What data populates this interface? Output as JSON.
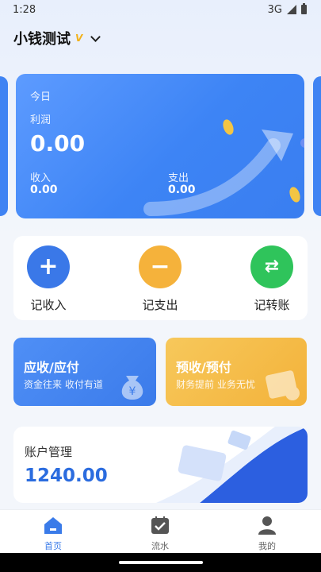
{
  "status_bar": {
    "time": "1:28",
    "network": "3G"
  },
  "header": {
    "title": "小钱测试",
    "vip": "V"
  },
  "today_card": {
    "date_label": "今日",
    "profit_label": "利润",
    "profit_value": "0.00",
    "income_label": "收入",
    "income_value": "0.00",
    "expense_label": "支出",
    "expense_value": "0.00"
  },
  "actions": {
    "income": {
      "label": "记收入",
      "icon": "plus-icon"
    },
    "expense": {
      "label": "记支出",
      "icon": "minus-icon"
    },
    "transfer": {
      "label": "记转账",
      "icon": "transfer-icon"
    }
  },
  "cards": {
    "receivable": {
      "title": "应收/应付",
      "subtitle": "资金往来 收付有道"
    },
    "prepaid": {
      "title": "预收/预付",
      "subtitle": "财务提前 业务无忧"
    }
  },
  "account": {
    "label": "账户管理",
    "value": "1240.00"
  },
  "bottom_nav": {
    "home": "首页",
    "flow": "流水",
    "me": "我的"
  },
  "colors": {
    "primary": "#3d84f5",
    "expense": "#f5b23b",
    "transfer": "#2fc45b",
    "account_value": "#2b6cdf"
  }
}
